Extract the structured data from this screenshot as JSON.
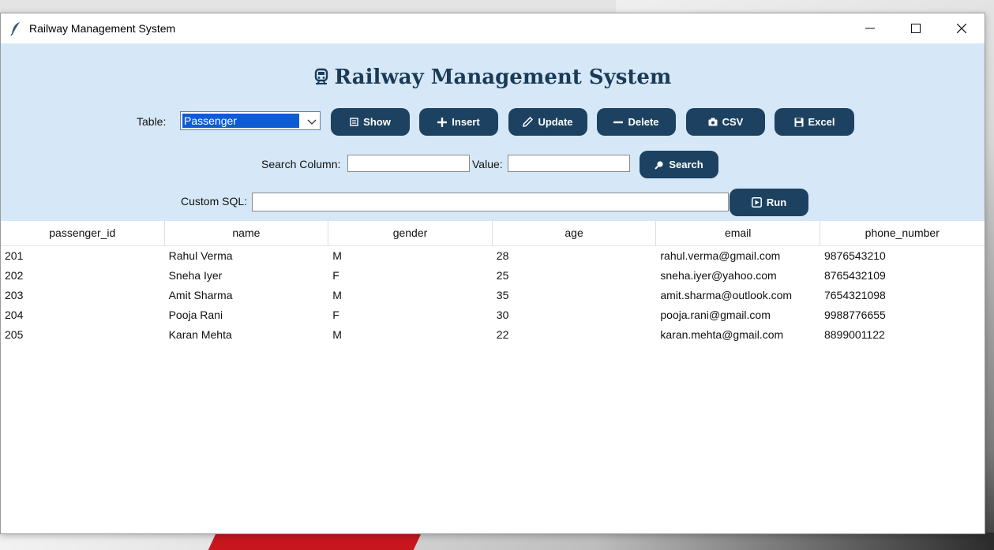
{
  "window": {
    "title": "Railway Management System"
  },
  "heading": "Railway Management System",
  "controls": {
    "table_label": "Table:",
    "table_value": "Passenger",
    "buttons": {
      "show": "Show",
      "insert": "Insert",
      "update": "Update",
      "delete": "Delete",
      "csv": "CSV",
      "excel": "Excel"
    },
    "search_column_label": "Search Column:",
    "search_column_value": "",
    "value_label": "Value:",
    "value_value": "",
    "search_button": "Search",
    "custom_sql_label": "Custom SQL:",
    "custom_sql_value": "",
    "run_button": "Run"
  },
  "table": {
    "columns": [
      "passenger_id",
      "name",
      "gender",
      "age",
      "email",
      "phone_number"
    ],
    "rows": [
      [
        "201",
        "Rahul Verma",
        "M",
        "28",
        "rahul.verma@gmail.com",
        "9876543210"
      ],
      [
        "202",
        "Sneha Iyer",
        "F",
        "25",
        "sneha.iyer@yahoo.com",
        "8765432109"
      ],
      [
        "203",
        "Amit Sharma",
        "M",
        "35",
        "amit.sharma@outlook.com",
        "7654321098"
      ],
      [
        "204",
        "Pooja Rani",
        "F",
        "30",
        "pooja.rani@gmail.com",
        "9988776655"
      ],
      [
        "205",
        "Karan Mehta",
        "M",
        "22",
        "karan.mehta@gmail.com",
        "8899001122"
      ]
    ]
  },
  "colors": {
    "panel": "#d6e8f7",
    "button": "#1d4261",
    "heading": "#1b3a57"
  }
}
